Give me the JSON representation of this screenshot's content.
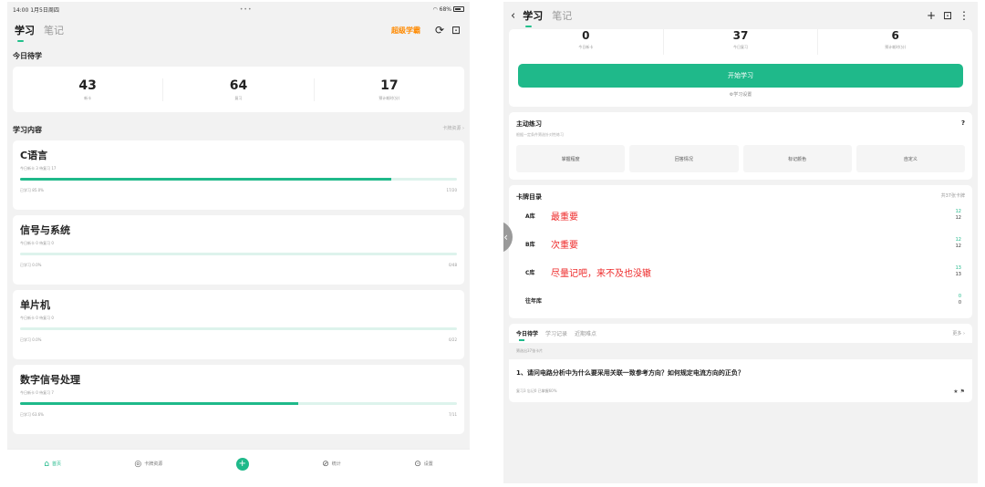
{
  "left": {
    "status": {
      "time": "14:00",
      "date": "1月5日周四",
      "dots": "•••",
      "battery": "68%"
    },
    "tabs": [
      "学习",
      "笔记"
    ],
    "brand": "超级学霸",
    "today_title": "今日待学",
    "stats": [
      {
        "num": "43",
        "label": "新卡"
      },
      {
        "num": "64",
        "label": "复习"
      },
      {
        "num": "17",
        "label": "预计耗时(分)"
      }
    ],
    "content_title": "学习内容",
    "content_more": "卡牌资源 ›",
    "courses": [
      {
        "name": "C语言",
        "sub": "今日新卡 3   待复习 17",
        "progress": 0.85,
        "foot_left": "已学习 85.0%",
        "foot_right": "17/20"
      },
      {
        "name": "信号与系统",
        "sub": "今日新卡 0   待复习 0",
        "progress": 0.0,
        "foot_left": "已学习 0.0%",
        "foot_right": "0/48"
      },
      {
        "name": "单片机",
        "sub": "今日新卡 0   待复习 0",
        "progress": 0.0,
        "foot_left": "已学习 0.0%",
        "foot_right": "0/22"
      },
      {
        "name": "数字信号处理",
        "sub": "今日新卡 0   待复习 7",
        "progress": 0.636,
        "foot_left": "已学习 63.6%",
        "foot_right": "7/11"
      }
    ],
    "tabbar": [
      "首页",
      "卡牌资源",
      "",
      "统计",
      "设置"
    ]
  },
  "right": {
    "tabs": [
      "学习",
      "笔记"
    ],
    "stats": [
      {
        "num": "0",
        "label": "今日新卡"
      },
      {
        "num": "37",
        "label": "今日复习"
      },
      {
        "num": "6",
        "label": "预计耗时(分)"
      }
    ],
    "start_label": "开始学习",
    "settings_link": "⚙学习设置",
    "practice": {
      "title": "主动练习",
      "desc": "根据一定条件筛选针对性练习",
      "chips": [
        "掌握程度",
        "回答情况",
        "标记颜色",
        "自定义"
      ]
    },
    "catalog": {
      "title": "卡牌目录",
      "count": "共37张卡牌",
      "libs": [
        {
          "name": "A库",
          "note": "最重要",
          "top": "12",
          "bottom": "12"
        },
        {
          "name": "B库",
          "note": "次重要",
          "top": "12",
          "bottom": "12"
        },
        {
          "name": "C库",
          "note": "尽量记吧，来不及也没辙",
          "top": "13",
          "bottom": "13"
        },
        {
          "name": "往年库",
          "note": "",
          "top": "0",
          "bottom": "0"
        }
      ]
    },
    "today_tabs": [
      "今日待学",
      "学习记录",
      "近期难点"
    ],
    "today_more": "更多 ›",
    "filter": "筛选出37张卡片",
    "question": {
      "text": "1、请问电路分析中为什么要采用关联一致参考方向？如何规定电流方向的正负？",
      "meta": "复习3  忘记0  已掌握60%"
    }
  }
}
